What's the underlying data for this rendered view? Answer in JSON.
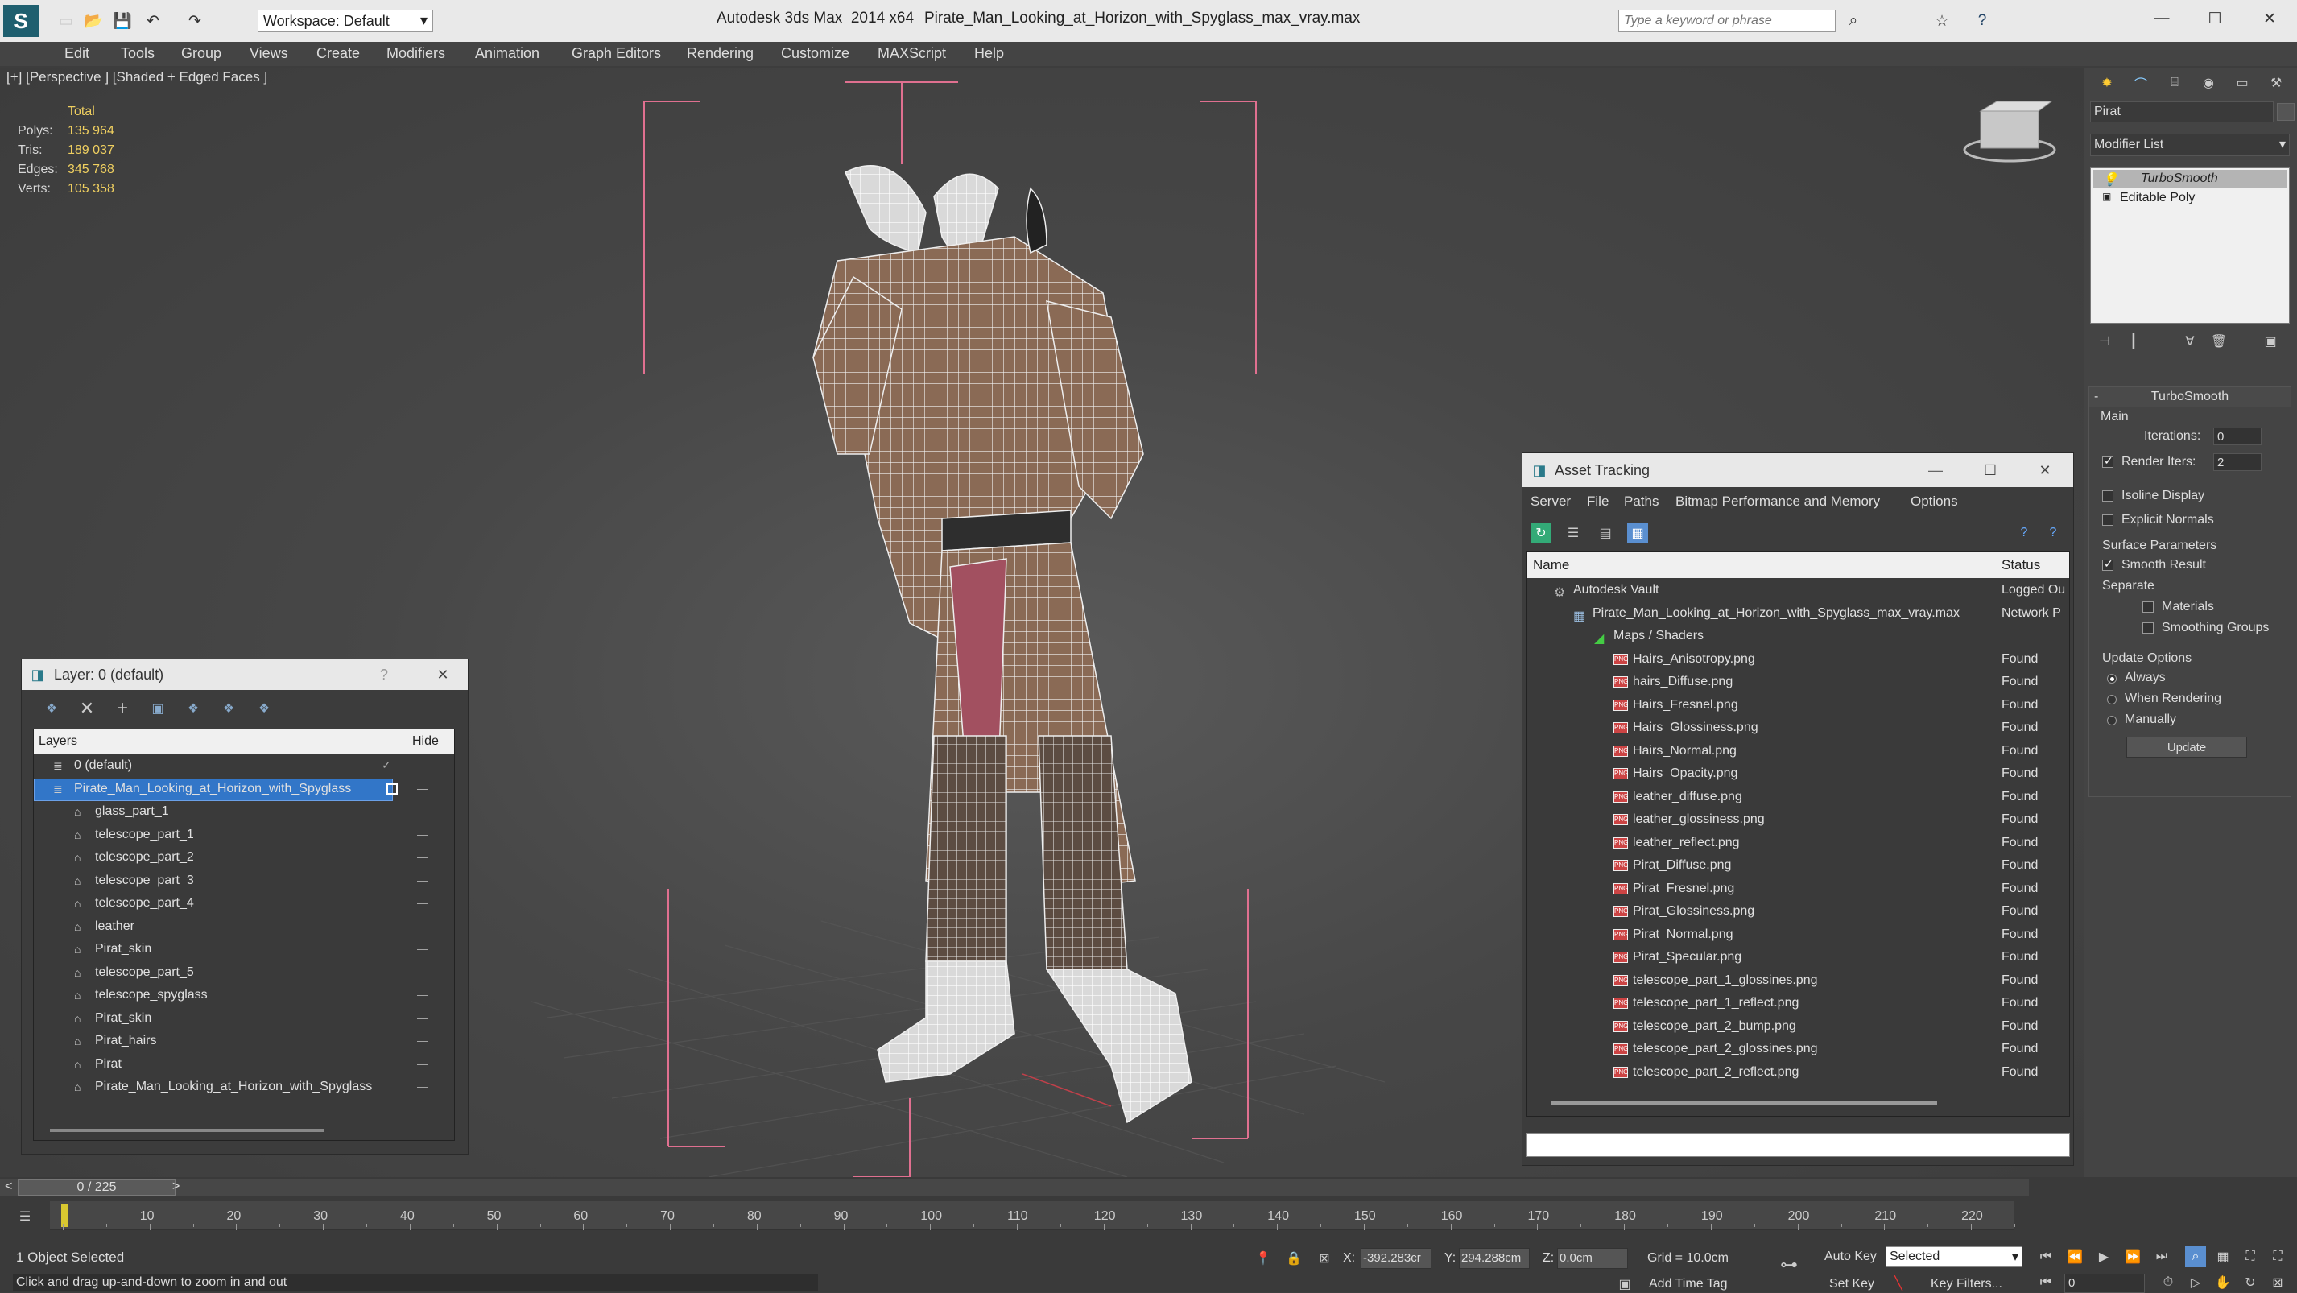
{
  "titlebar": {
    "app": "Autodesk 3ds Max  2014 x64",
    "file": "Pirate_Man_Looking_at_Horizon_with_Spyglass_max_vray.max",
    "workspace": "Workspace: Default",
    "search_placeholder": "Type a keyword or phrase"
  },
  "menu": [
    "Edit",
    "Tools",
    "Group",
    "Views",
    "Create",
    "Modifiers",
    "Animation",
    "Graph Editors",
    "Rendering",
    "Customize",
    "MAXScript",
    "Help"
  ],
  "viewport": {
    "label": "[+] [Perspective ] [Shaded + Edged Faces ]",
    "stats_header": "Total",
    "stats": [
      {
        "label": "Polys:",
        "value": "135 964"
      },
      {
        "label": "Tris:",
        "value": "189 037"
      },
      {
        "label": "Edges:",
        "value": "345 768"
      },
      {
        "label": "Verts:",
        "value": "105 358"
      }
    ]
  },
  "layer_panel": {
    "title": "Layer: 0 (default)",
    "help": "?",
    "col_layers": "Layers",
    "col_hide": "Hide",
    "rows": [
      {
        "name": "0 (default)",
        "level": 1,
        "selected": false
      },
      {
        "name": "Pirate_Man_Looking_at_Horizon_with_Spyglass",
        "level": 1,
        "selected": true
      },
      {
        "name": "glass_part_1",
        "level": 2,
        "selected": false
      },
      {
        "name": "telescope_part_1",
        "level": 2,
        "selected": false
      },
      {
        "name": "telescope_part_2",
        "level": 2,
        "selected": false
      },
      {
        "name": "telescope_part_3",
        "level": 2,
        "selected": false
      },
      {
        "name": "telescope_part_4",
        "level": 2,
        "selected": false
      },
      {
        "name": "leather",
        "level": 2,
        "selected": false
      },
      {
        "name": "Pirat_skin",
        "level": 2,
        "selected": false
      },
      {
        "name": "telescope_part_5",
        "level": 2,
        "selected": false
      },
      {
        "name": "telescope_spyglass",
        "level": 2,
        "selected": false
      },
      {
        "name": "Pirat_skin",
        "level": 2,
        "selected": false
      },
      {
        "name": "Pirat_hairs",
        "level": 2,
        "selected": false
      },
      {
        "name": "Pirat",
        "level": 2,
        "selected": false
      },
      {
        "name": "Pirate_Man_Looking_at_Horizon_with_Spyglass",
        "level": 2,
        "selected": false
      }
    ]
  },
  "asset_panel": {
    "title": "Asset Tracking",
    "menu": [
      "Server",
      "File",
      "Paths",
      "Bitmap Performance and Memory",
      "Options"
    ],
    "col_name": "Name",
    "col_status": "Status",
    "vault": {
      "name": "Autodesk Vault",
      "status": "Logged Ou"
    },
    "file": {
      "name": "Pirate_Man_Looking_at_Horizon_with_Spyglass_max_vray.max",
      "status": "Network P"
    },
    "maps": "Maps / Shaders",
    "png_badge": "PNG",
    "assets": [
      {
        "name": "Hairs_Anisotropy.png",
        "status": "Found"
      },
      {
        "name": "hairs_Diffuse.png",
        "status": "Found"
      },
      {
        "name": "Hairs_Fresnel.png",
        "status": "Found"
      },
      {
        "name": "Hairs_Glossiness.png",
        "status": "Found"
      },
      {
        "name": "Hairs_Normal.png",
        "status": "Found"
      },
      {
        "name": "Hairs_Opacity.png",
        "status": "Found"
      },
      {
        "name": "leather_diffuse.png",
        "status": "Found"
      },
      {
        "name": "leather_glossiness.png",
        "status": "Found"
      },
      {
        "name": "leather_reflect.png",
        "status": "Found"
      },
      {
        "name": "Pirat_Diffuse.png",
        "status": "Found"
      },
      {
        "name": "Pirat_Fresnel.png",
        "status": "Found"
      },
      {
        "name": "Pirat_Glossiness.png",
        "status": "Found"
      },
      {
        "name": "Pirat_Normal.png",
        "status": "Found"
      },
      {
        "name": "Pirat_Specular.png",
        "status": "Found"
      },
      {
        "name": "telescope_part_1_glossines.png",
        "status": "Found"
      },
      {
        "name": "telescope_part_1_reflect.png",
        "status": "Found"
      },
      {
        "name": "telescope_part_2_bump.png",
        "status": "Found"
      },
      {
        "name": "telescope_part_2_glossines.png",
        "status": "Found"
      },
      {
        "name": "telescope_part_2_reflect.png",
        "status": "Found"
      }
    ]
  },
  "command_panel": {
    "object_name": "Pirat",
    "modifier_list": "Modifier List",
    "stack": [
      "TurboSmooth",
      "Editable Poly"
    ],
    "rollout": "TurboSmooth",
    "main": "Main",
    "iterations_label": "Iterations:",
    "iterations_value": "0",
    "render_iters_label": "Render Iters:",
    "render_iters_value": "2",
    "isoline": "Isoline Display",
    "explicit": "Explicit Normals",
    "surface": "Surface Parameters",
    "smooth_result": "Smooth Result",
    "separate": "Separate",
    "materials": "Materials",
    "smoothing": "Smoothing Groups",
    "update_options": "Update Options",
    "always": "Always",
    "when_rendering": "When Rendering",
    "manually": "Manually",
    "update": "Update"
  },
  "timeline": {
    "frame": "0 / 225",
    "ticks": [
      "10",
      "20",
      "30",
      "40",
      "50",
      "60",
      "70",
      "80",
      "90",
      "100",
      "110",
      "120",
      "130",
      "140",
      "150",
      "160",
      "170",
      "180",
      "190",
      "200",
      "210",
      "220"
    ],
    "selected": "1 Object Selected",
    "prompt": "Click and drag up-and-down to zoom in and out",
    "x_label": "X:",
    "x": "-392.283cr",
    "y_label": "Y:",
    "y": "294.288cm",
    "z_label": "Z:",
    "z": "0.0cm",
    "grid": "Grid = 10.0cm",
    "auto_key": "Auto Key",
    "key_mode": "Selected",
    "set_key": "Set Key",
    "key_filters": "Key Filters...",
    "add_time_tag": "Add Time Tag",
    "frame_field": "0"
  }
}
